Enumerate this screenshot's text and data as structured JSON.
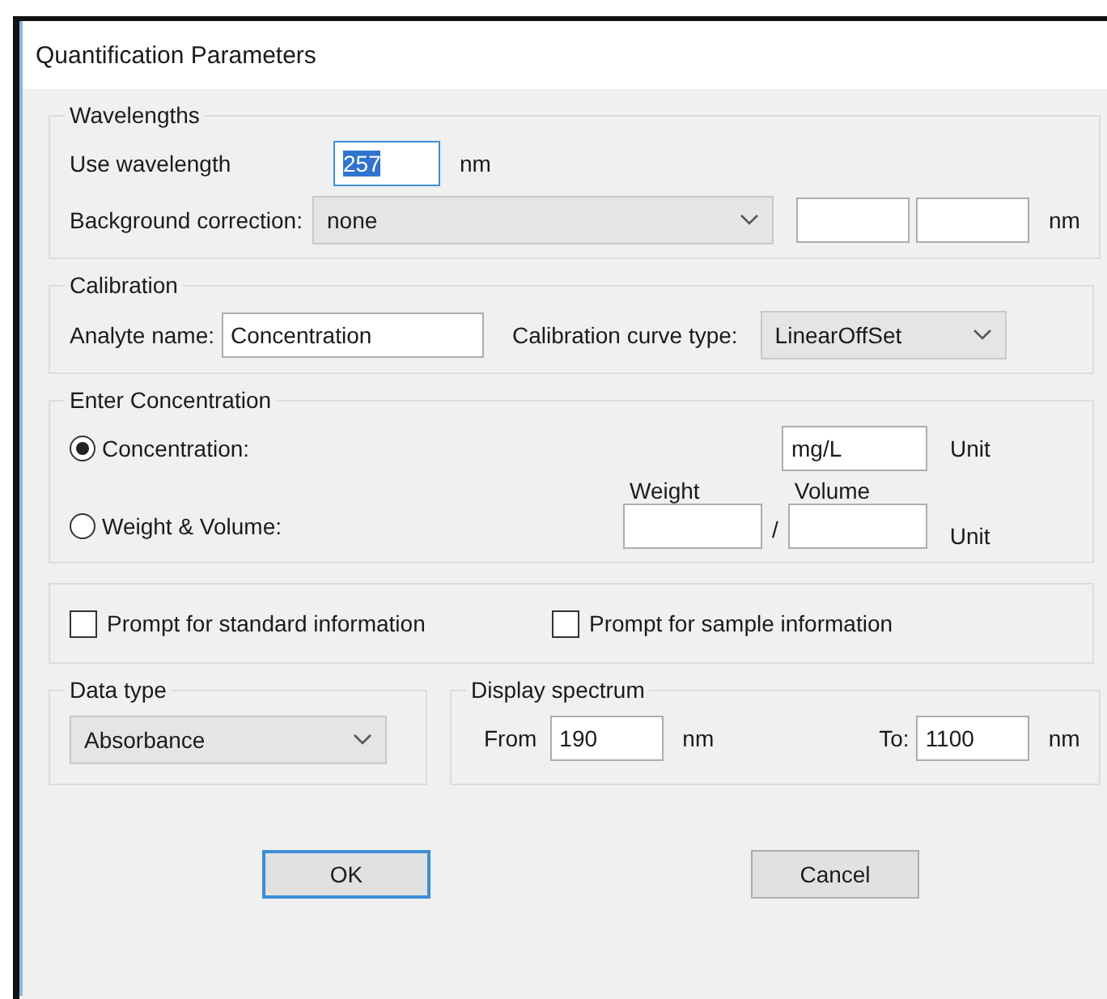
{
  "window": {
    "title": "Quantification Parameters"
  },
  "wavelengths": {
    "title": "Wavelengths",
    "use_label": "Use wavelength",
    "use_value": "257",
    "use_value_selected": true,
    "use_unit": "nm",
    "background_label": "Background correction:",
    "background_value": "none",
    "background_unit": "nm"
  },
  "calibration": {
    "title": "Calibration",
    "analyte_label": "Analyte name:",
    "analyte_value": "Concentration",
    "curve_label": "Calibration curve type:",
    "curve_value": "LinearOffSet"
  },
  "enter_concentration": {
    "title": "Enter Concentration",
    "options": [
      {
        "label": "Concentration:",
        "selected": true
      },
      {
        "label": "Weight & Volume:",
        "selected": false
      }
    ],
    "concentration_value": "mg/L",
    "concentration_unit": "Unit",
    "weight_label": "Weight",
    "volume_label": "Volume",
    "separator": "/",
    "weight_volume_unit": "Unit"
  },
  "prompts": [
    {
      "label": "Prompt for standard information",
      "checked": false
    },
    {
      "label": "Prompt for sample information",
      "checked": false
    }
  ],
  "data_type": {
    "title": "Data type",
    "value": "Absorbance"
  },
  "display_spectrum": {
    "title": "Display spectrum",
    "from_label": "From",
    "from_value": "190",
    "from_unit": "nm",
    "to_label": "To:",
    "to_value": "1100",
    "to_unit": "nm"
  },
  "buttons": [
    {
      "label": "OK",
      "default": true
    },
    {
      "label": "Cancel",
      "default": false
    }
  ]
}
